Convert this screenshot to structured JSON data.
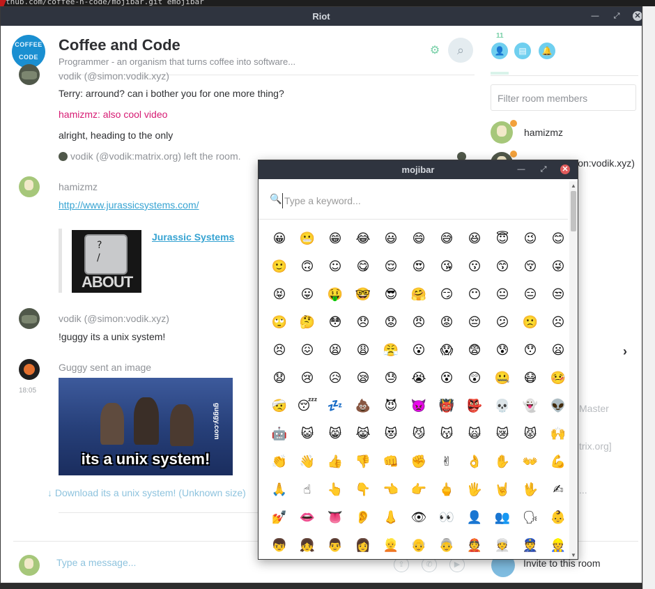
{
  "terminal": {
    "text": "thub.com/coffee-n-code/mojibar.git  emojibar"
  },
  "riot": {
    "window_title": "Riot",
    "room": {
      "avatar_line1": "COFFEE",
      "avatar_line2": "CODE",
      "name": "Coffee and Code",
      "topic": "Programmer - an organism that turns coffee into software..."
    },
    "right_panel": {
      "member_count": "11",
      "filter_placeholder": "Filter room members",
      "members": [
        {
          "name": "hamizmz"
        },
        {
          "name": "vodik (@simon:vodik.xyz)"
        }
      ],
      "peek_master": "Master",
      "peek_matrix": "trix.org]",
      "peek_dots": "...",
      "invite_label": "Invite to this room"
    },
    "timeline": {
      "m0_sender": "vodik (@simon:vodik.xyz)",
      "m0_line1": "Terry: arround? can i bother you for one more thing?",
      "m0_line2": "hamizmz: also cool video",
      "m0_line3": "alright, heading to the only",
      "m0_event": "vodik (@vodik:matrix.org) left the room.",
      "m1_sender": "hamizmz",
      "m1_link": "http://www.jurassicsystems.com/",
      "m1_preview_title": "Jurassic Systems",
      "m1_preview_key_q": "?",
      "m1_preview_key_slash": "/",
      "m1_preview_about": "ABOUT",
      "m2_sender": "vodik (@simon:vodik.xyz)",
      "m2_body": "!guggy its a unix system!",
      "m3_sender": "Guggy sent an image",
      "m3_time": "18:05",
      "m3_caption": "its a unix system!",
      "m3_watermark": "guggy.com",
      "m3_download": "↓ Download its a unix system! (Unknown size)"
    },
    "composer": {
      "placeholder": "Type a message..."
    }
  },
  "mojibar": {
    "window_title": "mojibar",
    "search_placeholder": "Type a keyword...",
    "emoji_rows": [
      [
        "😀",
        "😬",
        "😁",
        "😂",
        "😃",
        "😄",
        "😅",
        "😆",
        "😇",
        "😉",
        "😊"
      ],
      [
        "🙂",
        "🙃",
        "☺",
        "😋",
        "😌",
        "😍",
        "😘",
        "😗",
        "😙",
        "😚",
        "😜"
      ],
      [
        "😝",
        "😛",
        "🤑",
        "🤓",
        "😎",
        "🤗",
        "😏",
        "😶",
        "😐",
        "😑",
        "😒"
      ],
      [
        "🙄",
        "🤔",
        "😳",
        "😞",
        "😟",
        "😠",
        "😡",
        "😔",
        "😕",
        "🙁",
        "☹"
      ],
      [
        "😣",
        "😖",
        "😫",
        "😩",
        "😤",
        "😮",
        "😱",
        "😨",
        "😰",
        "😯",
        "😦"
      ],
      [
        "😧",
        "😢",
        "😥",
        "😪",
        "😓",
        "😭",
        "😵",
        "😲",
        "🤐",
        "😷",
        "🤒"
      ],
      [
        "🤕",
        "😴",
        "💤",
        "💩",
        "😈",
        "👿",
        "👹",
        "👺",
        "💀",
        "👻",
        "👽"
      ],
      [
        "🤖",
        "😺",
        "😸",
        "😹",
        "😻",
        "😼",
        "😽",
        "🙀",
        "😿",
        "😾",
        "🙌"
      ],
      [
        "👏",
        "👋",
        "👍",
        "👎",
        "👊",
        "✊",
        "✌",
        "👌",
        "✋",
        "👐",
        "💪"
      ],
      [
        "🙏",
        "☝",
        "👆",
        "👇",
        "👈",
        "👉",
        "🖕",
        "🖐",
        "🤘",
        "🖖",
        "✍"
      ],
      [
        "💅",
        "👄",
        "👅",
        "👂",
        "👃",
        "👁",
        "👀",
        "👤",
        "👥",
        "🗣",
        "👶"
      ],
      [
        "👦",
        "👧",
        "👨",
        "👩",
        "👱",
        "👴",
        "👵",
        "👲",
        "👳",
        "👮",
        "👷"
      ]
    ]
  }
}
